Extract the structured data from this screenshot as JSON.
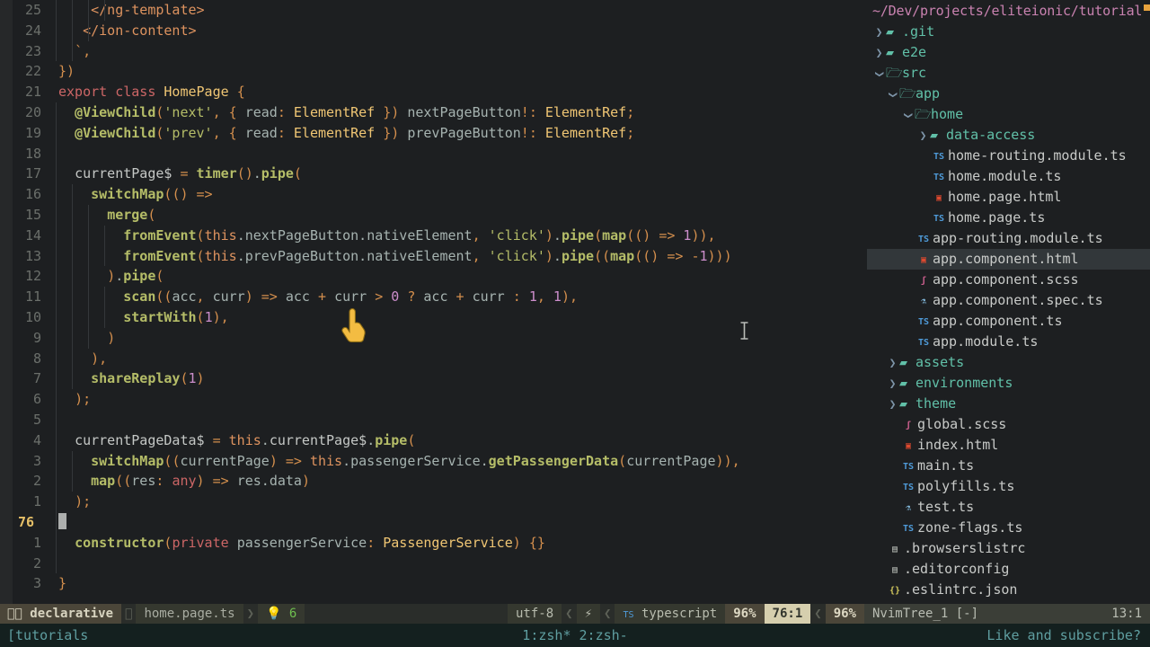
{
  "editor": {
    "current_line_number": "76",
    "lines": [
      {
        "num": "25",
        "indents": 4
      },
      {
        "num": "24",
        "indents": 3
      },
      {
        "num": "23",
        "indents": 2
      },
      {
        "num": "22",
        "indents": 0
      },
      {
        "num": "21",
        "indents": 0
      },
      {
        "num": "20",
        "indents": 1
      },
      {
        "num": "19",
        "indents": 1
      },
      {
        "num": "18",
        "indents": 1
      },
      {
        "num": "17",
        "indents": 1
      },
      {
        "num": "16",
        "indents": 2
      },
      {
        "num": "15",
        "indents": 3
      },
      {
        "num": "14",
        "indents": 4
      },
      {
        "num": "13",
        "indents": 4
      },
      {
        "num": "12",
        "indents": 3
      },
      {
        "num": "11",
        "indents": 4
      },
      {
        "num": "10",
        "indents": 4
      },
      {
        "num": "9",
        "indents": 3
      },
      {
        "num": "8",
        "indents": 2
      },
      {
        "num": "7",
        "indents": 2
      },
      {
        "num": "6",
        "indents": 1
      },
      {
        "num": "5",
        "indents": 1
      },
      {
        "num": "4",
        "indents": 1
      },
      {
        "num": "3",
        "indents": 2
      },
      {
        "num": "2",
        "indents": 2
      },
      {
        "num": "1",
        "indents": 1
      },
      {
        "num": "76",
        "indents": 1,
        "current": true
      },
      {
        "num": "1",
        "indents": 1
      },
      {
        "num": "2",
        "indents": 1
      },
      {
        "num": "3",
        "indents": 0
      }
    ],
    "code_text": [
      "    </ng-template>",
      "   </ion-content>",
      "  `,",
      "})",
      "export class HomePage {",
      "  @ViewChild('next', { read: ElementRef }) nextPageButton!: ElementRef;",
      "  @ViewChild('prev', { read: ElementRef }) prevPageButton!: ElementRef;",
      "",
      "  currentPage$ = timer().pipe(",
      "    switchMap(() =>",
      "      merge(",
      "        fromEvent(this.nextPageButton.nativeElement, 'click').pipe(map(() => 1)),",
      "        fromEvent(this.prevPageButton.nativeElement, 'click').pipe((map(() => -1)))",
      "      ).pipe(",
      "        scan((acc, curr) => acc + curr > 0 ? acc + curr : 1, 1),",
      "        startWith(1),",
      "      )",
      "    ),",
      "    shareReplay(1)",
      "  );",
      "",
      "  currentPageData$ = this.currentPage$.pipe(",
      "    switchMap((currentPage) => this.passengerService.getPassengerData(currentPage)),",
      "    map((res: any) => res.data)",
      "  );",
      "",
      "  constructor(private passengerService: PassengerService) {}",
      "",
      "}"
    ]
  },
  "tree": {
    "header_path": "~/Dev/projects/eliteionic/tutorial",
    "items": [
      {
        "label": ".git",
        "indent": 0,
        "kind": "dir",
        "state": "closed"
      },
      {
        "label": "e2e",
        "indent": 0,
        "kind": "dir",
        "state": "closed"
      },
      {
        "label": "src",
        "indent": 0,
        "kind": "dir",
        "state": "open"
      },
      {
        "label": "app",
        "indent": 1,
        "kind": "dir",
        "state": "open"
      },
      {
        "label": "home",
        "indent": 2,
        "kind": "dir",
        "state": "open"
      },
      {
        "label": "data-access",
        "indent": 3,
        "kind": "dir",
        "state": "closed"
      },
      {
        "label": "home-routing.module.ts",
        "indent": 3,
        "kind": "file",
        "ftype": "ts"
      },
      {
        "label": "home.module.ts",
        "indent": 3,
        "kind": "file",
        "ftype": "ts"
      },
      {
        "label": "home.page.html",
        "indent": 3,
        "kind": "file",
        "ftype": "html"
      },
      {
        "label": "home.page.ts",
        "indent": 3,
        "kind": "file",
        "ftype": "ts"
      },
      {
        "label": "app-routing.module.ts",
        "indent": 2,
        "kind": "file",
        "ftype": "ts"
      },
      {
        "label": "app.component.html",
        "indent": 2,
        "kind": "file",
        "ftype": "html",
        "selected": true
      },
      {
        "label": "app.component.scss",
        "indent": 2,
        "kind": "file",
        "ftype": "scss"
      },
      {
        "label": "app.component.spec.ts",
        "indent": 2,
        "kind": "file",
        "ftype": "spec"
      },
      {
        "label": "app.component.ts",
        "indent": 2,
        "kind": "file",
        "ftype": "ts"
      },
      {
        "label": "app.module.ts",
        "indent": 2,
        "kind": "file",
        "ftype": "ts"
      },
      {
        "label": "assets",
        "indent": 1,
        "kind": "dir",
        "state": "closed"
      },
      {
        "label": "environments",
        "indent": 1,
        "kind": "dir",
        "state": "closed"
      },
      {
        "label": "theme",
        "indent": 1,
        "kind": "dir",
        "state": "closed"
      },
      {
        "label": "global.scss",
        "indent": 1,
        "kind": "file",
        "ftype": "scss"
      },
      {
        "label": "index.html",
        "indent": 1,
        "kind": "file",
        "ftype": "html"
      },
      {
        "label": "main.ts",
        "indent": 1,
        "kind": "file",
        "ftype": "ts"
      },
      {
        "label": "polyfills.ts",
        "indent": 1,
        "kind": "file",
        "ftype": "ts"
      },
      {
        "label": "test.ts",
        "indent": 1,
        "kind": "file",
        "ftype": "spec"
      },
      {
        "label": "zone-flags.ts",
        "indent": 1,
        "kind": "file",
        "ftype": "ts"
      },
      {
        "label": ".browserslistrc",
        "indent": 0,
        "kind": "file",
        "ftype": "txt"
      },
      {
        "label": ".editorconfig",
        "indent": 0,
        "kind": "file",
        "ftype": "txt"
      },
      {
        "label": ".eslintrc.json",
        "indent": 0,
        "kind": "file",
        "ftype": "json"
      }
    ]
  },
  "statusline": {
    "branch_name": "declarative",
    "file_name": "home.page.ts",
    "hint_count": "6",
    "encoding": "utf-8",
    "fileformat_icon": "unix-icon",
    "filetype": "typescript",
    "scroll_percent_left": "96%",
    "cursor_position": "76:1",
    "scroll_percent_right": "96%",
    "tree_window_name": "NvimTree_1 [-]",
    "tree_position": "13:1"
  },
  "tmux": {
    "session": "[tutorials",
    "windows": "1:zsh* 2:zsh-",
    "right_message": "Like and subscribe?"
  },
  "colors": {
    "editor_bg": "#1d1f21",
    "accent_selected_row": "#32373a",
    "branch_segment_bg": "#4b4639",
    "position_segment_bg": "#d6cfae",
    "tmux_bg": "#14201f",
    "tmux_fg": "#5f9ea0",
    "dir_color": "#61c0a8",
    "path_color": "#c982b0"
  }
}
